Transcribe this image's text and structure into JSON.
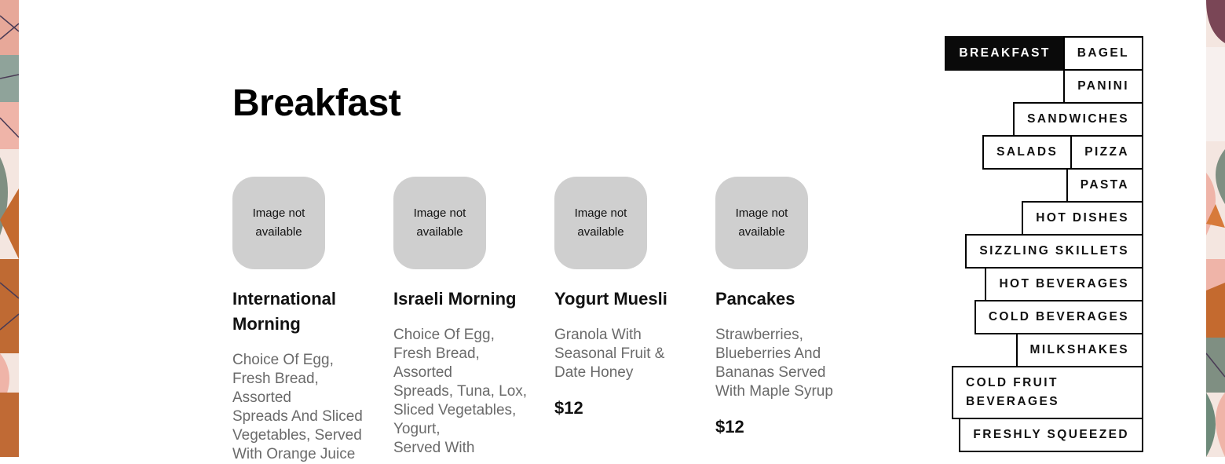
{
  "page": {
    "title": "Breakfast"
  },
  "menu_items": [
    {
      "image_placeholder": "Image not available",
      "name": "International Morning",
      "description": "Choice Of Egg,\nFresh Bread,\nAssorted\nSpreads And Sliced\nVegetables, Served\nWith Orange Juice",
      "price": ""
    },
    {
      "image_placeholder": "Image not available",
      "name": "Israeli Morning",
      "description": "Choice Of Egg,\nFresh Bread,\nAssorted\nSpreads, Tuna, Lox,\nSliced Vegetables,\nYogurt,\nServed With",
      "price": ""
    },
    {
      "image_placeholder": "Image not available",
      "name": "Yogurt Muesli",
      "description": "Granola With\nSeasonal Fruit &\nDate Honey",
      "price": "$12"
    },
    {
      "image_placeholder": "Image not available",
      "name": "Pancakes",
      "description": "Strawberries,\nBlueberries And\nBananas Served\nWith Maple Syrup",
      "price": "$12"
    }
  ],
  "categories": {
    "active": "BREAKFAST",
    "rows": [
      [
        "BREAKFAST",
        "BAGEL"
      ],
      [
        "PANINI"
      ],
      [
        "SANDWICHES"
      ],
      [
        "SALADS",
        "PIZZA"
      ],
      [
        "PASTA"
      ],
      [
        "HOT DISHES"
      ],
      [
        "SIZZLING SKILLETS"
      ],
      [
        "HOT BEVERAGES"
      ],
      [
        "COLD BEVERAGES"
      ],
      [
        "MILKSHAKES"
      ],
      [
        "COLD FRUIT BEVERAGES"
      ],
      [
        "FRESHLY SQUEEZED"
      ]
    ]
  },
  "colors": {
    "active_bg": "#0a0a0a",
    "placeholder_bg": "#cfcfcf",
    "desc_text": "#6a6a6a"
  }
}
